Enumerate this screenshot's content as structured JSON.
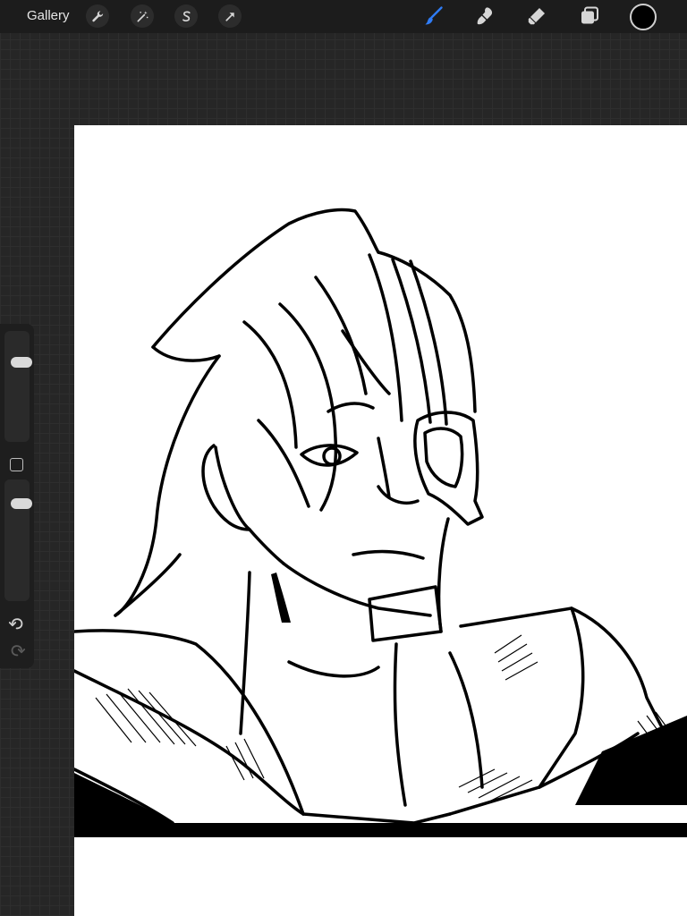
{
  "topbar": {
    "gallery_label": "Gallery",
    "left_tools": [
      {
        "id": "actions",
        "icon": "wrench-icon"
      },
      {
        "id": "adjustments",
        "icon": "magic-wand-icon"
      },
      {
        "id": "selection",
        "icon": "selection-s-icon"
      },
      {
        "id": "transform",
        "icon": "arrow-cursor-icon"
      }
    ],
    "right_tools": [
      {
        "id": "brush",
        "icon": "brush-icon",
        "active": true
      },
      {
        "id": "smudge",
        "icon": "smudge-icon",
        "active": false
      },
      {
        "id": "eraser",
        "icon": "eraser-icon",
        "active": false
      },
      {
        "id": "layers",
        "icon": "layers-icon",
        "active": false
      }
    ],
    "current_color": "#000000"
  },
  "colors": {
    "active_tool": "#2f7cf6",
    "inactive_tool": "#d6d6d6",
    "toolbar_bg": "#1c1c1c",
    "canvas_bg": "#ffffff",
    "workspace_bg": "#262626"
  },
  "sidebar": {
    "brush_size_level": 0.76,
    "brush_opacity_level": 0.85,
    "undo_icon": "undo-icon",
    "redo_icon": "redo-icon",
    "modify_icon": "square-icon"
  }
}
